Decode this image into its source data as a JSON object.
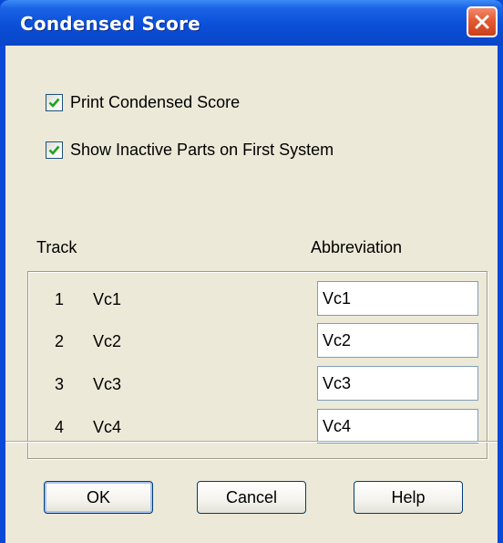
{
  "window": {
    "title": "Condensed Score"
  },
  "options": {
    "print_condensed": {
      "label": "Print Condensed Score",
      "checked": true
    },
    "show_inactive": {
      "label": "Show Inactive Parts on First System",
      "checked": true
    }
  },
  "table": {
    "track_header": "Track",
    "abbreviation_header": "Abbreviation",
    "rows": [
      {
        "num": "1",
        "name": "Vc1",
        "abbr": "Vc1"
      },
      {
        "num": "2",
        "name": "Vc2",
        "abbr": "Vc2"
      },
      {
        "num": "3",
        "name": "Vc3",
        "abbr": "Vc3"
      },
      {
        "num": "4",
        "name": "Vc4",
        "abbr": "Vc4"
      }
    ]
  },
  "buttons": {
    "ok": "OK",
    "cancel": "Cancel",
    "help": "Help"
  },
  "icons": {
    "close": "close-icon",
    "check": "checkmark-icon"
  },
  "colors": {
    "titlebar": "#0b4fd8",
    "dialog_bg": "#ece9d8",
    "close_button": "#e45a32",
    "checkmark": "#21a121"
  }
}
